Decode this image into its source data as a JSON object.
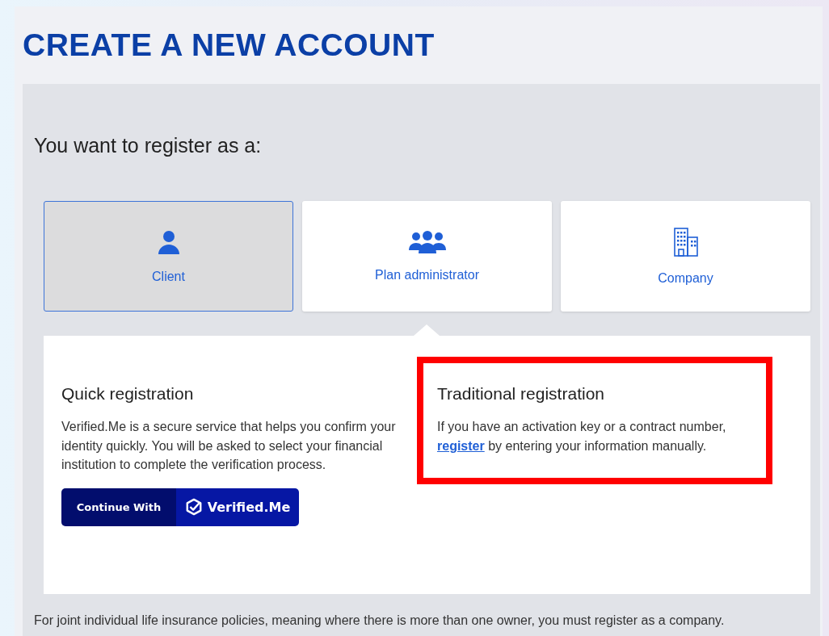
{
  "header": {
    "title": "CREATE A NEW ACCOUNT"
  },
  "question": "You want to register as a:",
  "account_types": [
    {
      "label": "Client",
      "selected": true,
      "kind": "person"
    },
    {
      "label": "Plan administrator",
      "selected": false,
      "kind": "group"
    },
    {
      "label": "Company",
      "selected": false,
      "kind": "building"
    }
  ],
  "options": [
    {
      "kind": "quick",
      "title": "Quick registration",
      "text": "Verified.Me is a secure service that helps you confirm your identity quickly. You will be asked to select your financial institution to complete the verification process.",
      "highlighted": false,
      "button": {
        "left": "Continue With",
        "right": "Verified.Me"
      }
    },
    {
      "kind": "traditional",
      "title": "Traditional registration",
      "text_before": "If you have an activation key or a contract number,",
      "link": "register",
      "text_after": "by entering your information manually.",
      "highlighted": true
    }
  ],
  "note": "For joint individual life insurance policies, meaning where there is more than one owner, you must register as a company."
}
